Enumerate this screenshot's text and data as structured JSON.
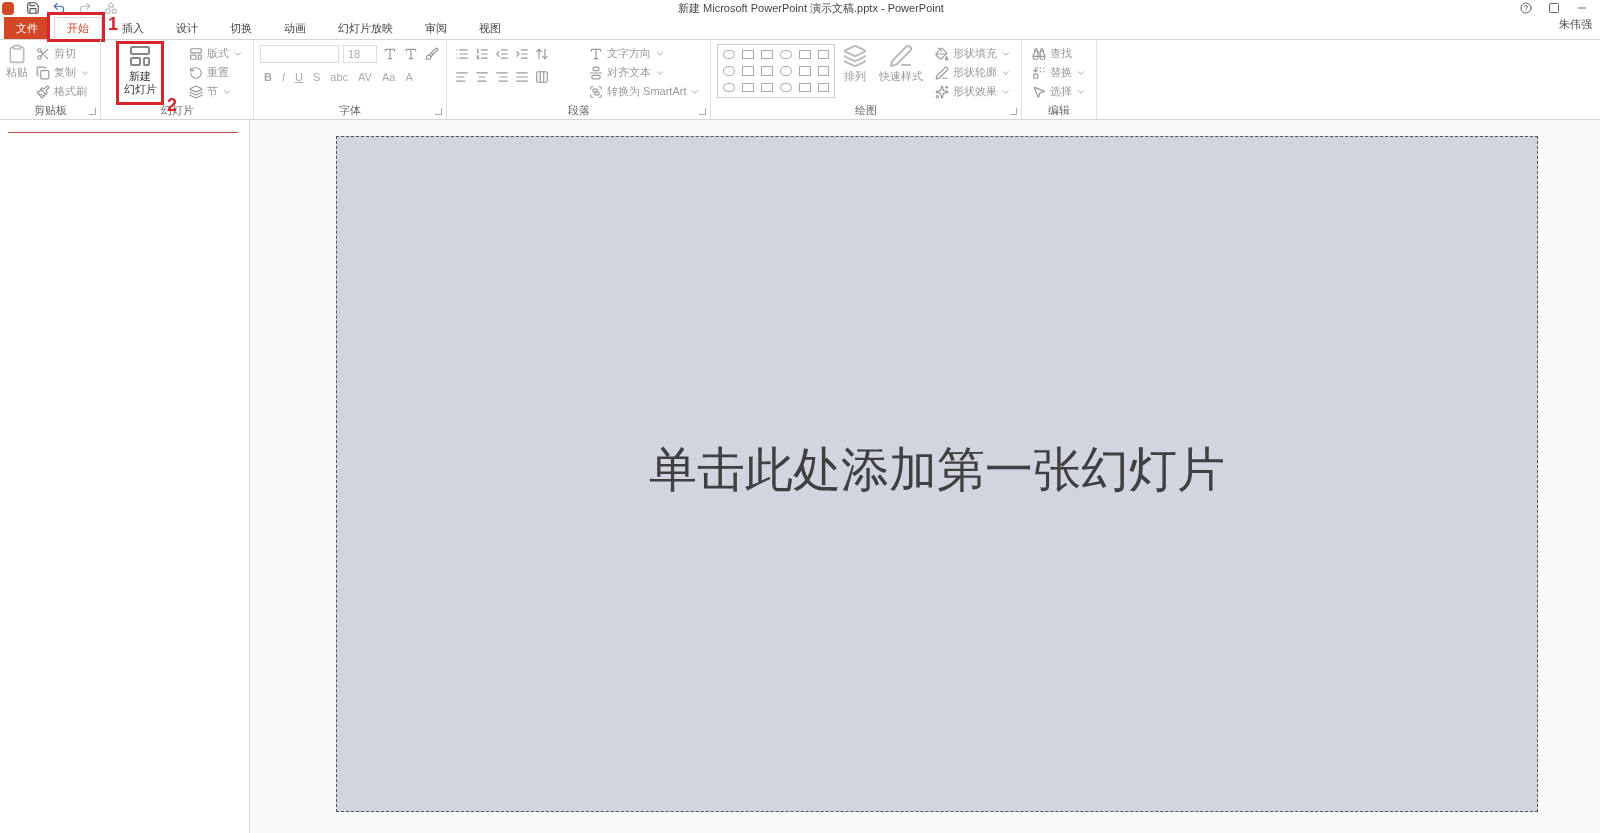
{
  "window": {
    "title": "新建 Microsoft PowerPoint 演示文稿.pptx - PowerPoint",
    "user": "朱伟强"
  },
  "tabs": [
    {
      "label": "文件",
      "kind": "file",
      "selected": false
    },
    {
      "label": "开始",
      "kind": "tab",
      "selected": true,
      "annotation": "1"
    },
    {
      "label": "插入",
      "kind": "tab",
      "selected": false
    },
    {
      "label": "设计",
      "kind": "tab",
      "selected": false
    },
    {
      "label": "切换",
      "kind": "tab",
      "selected": false
    },
    {
      "label": "动画",
      "kind": "tab",
      "selected": false
    },
    {
      "label": "幻灯片放映",
      "kind": "tab",
      "selected": false
    },
    {
      "label": "审阅",
      "kind": "tab",
      "selected": false
    },
    {
      "label": "视图",
      "kind": "tab",
      "selected": false
    }
  ],
  "clipboard": {
    "label": "剪贴板",
    "paste": "粘贴",
    "items": [
      "剪切",
      "复制",
      "格式刷"
    ]
  },
  "slides": {
    "label": "幻灯片",
    "new_slide": {
      "label_lines": [
        "新建",
        "幻灯片"
      ],
      "annotation": "2"
    },
    "items": [
      "版式",
      "重置",
      "节"
    ]
  },
  "font": {
    "label": "字体",
    "font_size": "18",
    "format_glyphs": [
      "B",
      "I",
      "U",
      "S",
      "abc",
      "AV",
      "Aa",
      "A"
    ]
  },
  "paragraph": {
    "label": "段落",
    "items": [
      "文字方向",
      "对齐文本",
      "转换为 SmartArt"
    ]
  },
  "drawing": {
    "label": "绘图",
    "arrange": "排列",
    "quick_styles": "快速样式",
    "items": [
      "形状填充",
      "形状轮廓",
      "形状效果"
    ]
  },
  "editing": {
    "label": "编辑",
    "items": [
      "查找",
      "替换",
      "选择"
    ]
  },
  "slide": {
    "placeholder": "单击此处添加第一张幻灯片"
  }
}
